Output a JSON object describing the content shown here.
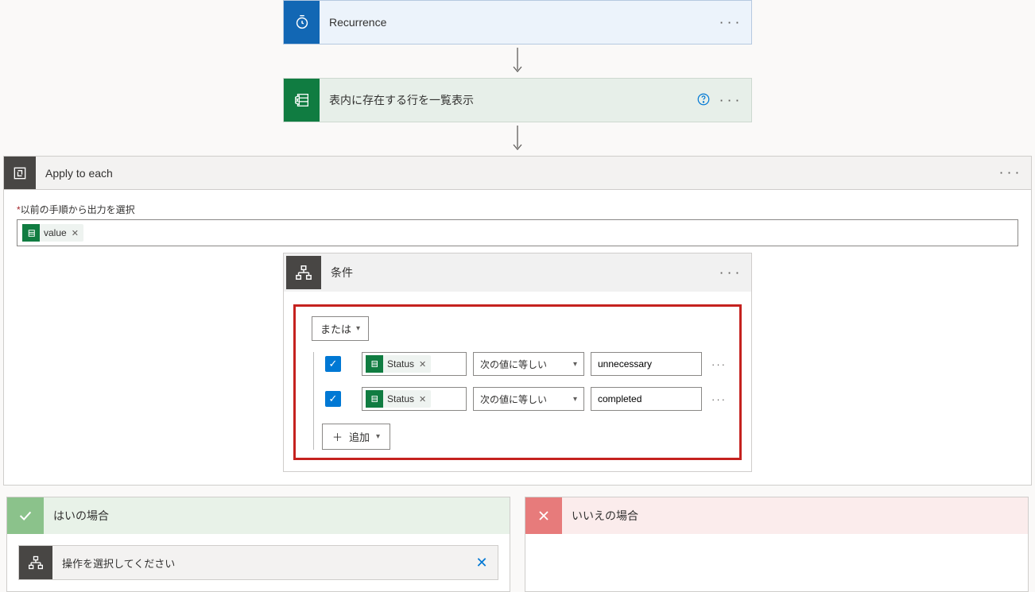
{
  "trigger": {
    "title": "Recurrence"
  },
  "excelAction": {
    "title": "表内に存在する行を一覧表示"
  },
  "foreach": {
    "title": "Apply to each",
    "prevOutputLabel": "以前の手順から出力を選択",
    "tokenValue": "value"
  },
  "condition": {
    "title": "条件",
    "groupOp": "または",
    "rows": [
      {
        "field": "Status",
        "op": "次の値に等しい",
        "value": "unnecessary"
      },
      {
        "field": "Status",
        "op": "次の値に等しい",
        "value": "completed"
      }
    ],
    "addLabel": "追加"
  },
  "branches": {
    "yes": "はいの場合",
    "no": "いいえの場合",
    "selectOp": "操作を選択してください"
  }
}
